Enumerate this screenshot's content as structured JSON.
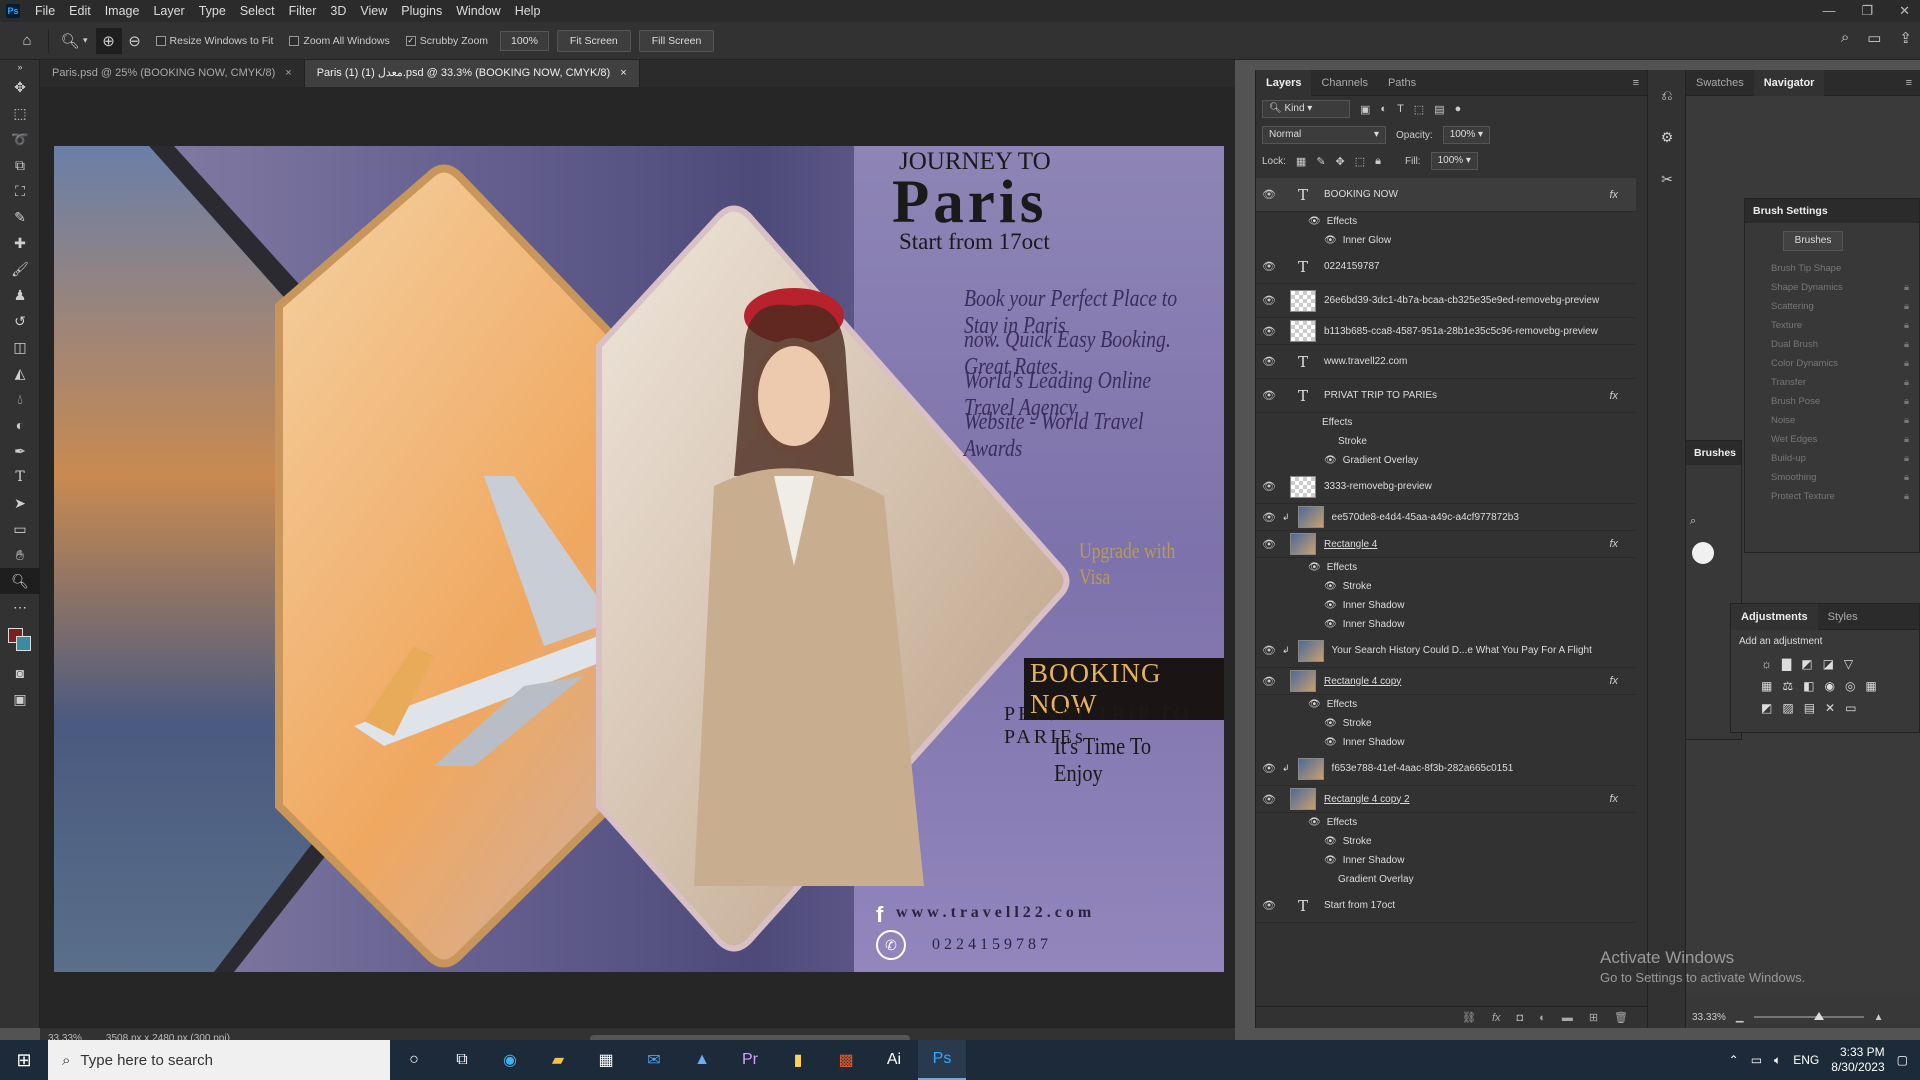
{
  "menu": [
    "File",
    "Edit",
    "Image",
    "Layer",
    "Type",
    "Select",
    "Filter",
    "3D",
    "View",
    "Plugins",
    "Window",
    "Help"
  ],
  "options": {
    "resize_windows": "Resize Windows to Fit",
    "zoom_all": "Zoom All Windows",
    "scrubby_zoom": "Scrubby Zoom",
    "zoom_value": "100%",
    "fit_screen": "Fit Screen",
    "fill_screen": "Fill Screen"
  },
  "tabs": [
    {
      "label": "Paris.psd @ 25% (BOOKING NOW, CMYK/8)"
    },
    {
      "label": "Paris (1) (1) معدل.psd @ 33.3% (BOOKING NOW, CMYK/8)"
    }
  ],
  "poster": {
    "journey": "JOURNEY TO",
    "paris": "Paris",
    "start": "Start from 17oct",
    "copy1": "Book your Perfect Place to Stay in Paris",
    "copy2": "now. Quick Easy Booking. Great Rates.",
    "copy3": "World's Leading Online Travel Agency",
    "copy4": "Website - World Travel Awards",
    "upgrade": "Upgrade with Visa",
    "booking": "BOOKING NOW",
    "privat": "PRIVAT TRIP TO PARIEs",
    "enjoy": "It's Time To Enjoy",
    "website": "w w w . t r a v e l l 2 2 . c o m",
    "phone": "0 2 2 4 1 5 9 7 8 7"
  },
  "status": {
    "zoom": "33.33%",
    "doc": "3508 px x 2480 px (300 ppi)"
  },
  "layers_panel": {
    "tabs": [
      "Layers",
      "Channels",
      "Paths"
    ],
    "kind": "Kind",
    "blend": "Normal",
    "opacity_label": "Opacity:",
    "opacity": "100%",
    "lock_label": "Lock:",
    "fill_label": "Fill:",
    "fill": "100%",
    "effects_label": "Effects",
    "layers": [
      {
        "name": "BOOKING NOW",
        "kind": "type",
        "fx": true,
        "effects": [
          "Inner Glow"
        ]
      },
      {
        "name": "0224159787",
        "kind": "type"
      },
      {
        "name": "26e6bd39-3dc1-4b7a-bcaa-cb325e35e9ed-removebg-preview",
        "kind": "trans"
      },
      {
        "name": "b113b685-cca8-4587-951a-28b1e35c5c96-removebg-preview",
        "kind": "trans"
      },
      {
        "name": "www.travell22.com",
        "kind": "type"
      },
      {
        "name": "PRIVAT TRIP TO PARIEs",
        "kind": "type",
        "fx": true,
        "effects": [
          "Stroke",
          "Gradient Overlay"
        ]
      },
      {
        "name": "3333-removebg-preview",
        "kind": "trans"
      },
      {
        "name": "ee570de8-e4d4-45aa-a49c-a4cf977872b3",
        "kind": "img"
      },
      {
        "name": "Rectangle 4",
        "kind": "img",
        "fx": true,
        "effects": [
          "Stroke",
          "Inner Shadow",
          "Inner Shadow"
        ]
      },
      {
        "name": "Your Search History Could D...e What You Pay For A Flight",
        "kind": "img"
      },
      {
        "name": "Rectangle 4 copy",
        "kind": "img",
        "fx": true,
        "effects": [
          "Stroke",
          "Inner Shadow"
        ]
      },
      {
        "name": "f653e788-41ef-4aac-8f3b-282a665c0151",
        "kind": "img"
      },
      {
        "name": "Rectangle 4 copy 2",
        "kind": "img",
        "fx": true,
        "effects": [
          "Stroke",
          "Inner Shadow",
          "Gradient Overlay"
        ]
      },
      {
        "name": "Start from 17oct",
        "kind": "type"
      }
    ]
  },
  "right_panels": {
    "swatches": "Swatches",
    "navigator": "Navigator",
    "brush_settings": "Brush Settings",
    "brushes_btn": "Brushes",
    "brush_items": [
      "Brush Tip Shape",
      "Shape Dynamics",
      "Scattering",
      "Texture",
      "Dual Brush",
      "Color Dynamics",
      "Transfer",
      "Brush Pose",
      "Noise",
      "Wet Edges",
      "Build-up",
      "Smoothing",
      "Protect Texture"
    ],
    "brushes_title": "Brushes",
    "adjustments": "Adjustments",
    "styles": "Styles",
    "add_adjustment": "Add an adjustment",
    "nav_zoom": "33.33%"
  },
  "watermark": {
    "line1": "Activate Windows",
    "line2": "Go to Settings to activate Windows."
  },
  "taskbar": {
    "search": "Type here to search",
    "lang": "ENG",
    "time": "3:33 PM",
    "date": "8/30/2023"
  }
}
